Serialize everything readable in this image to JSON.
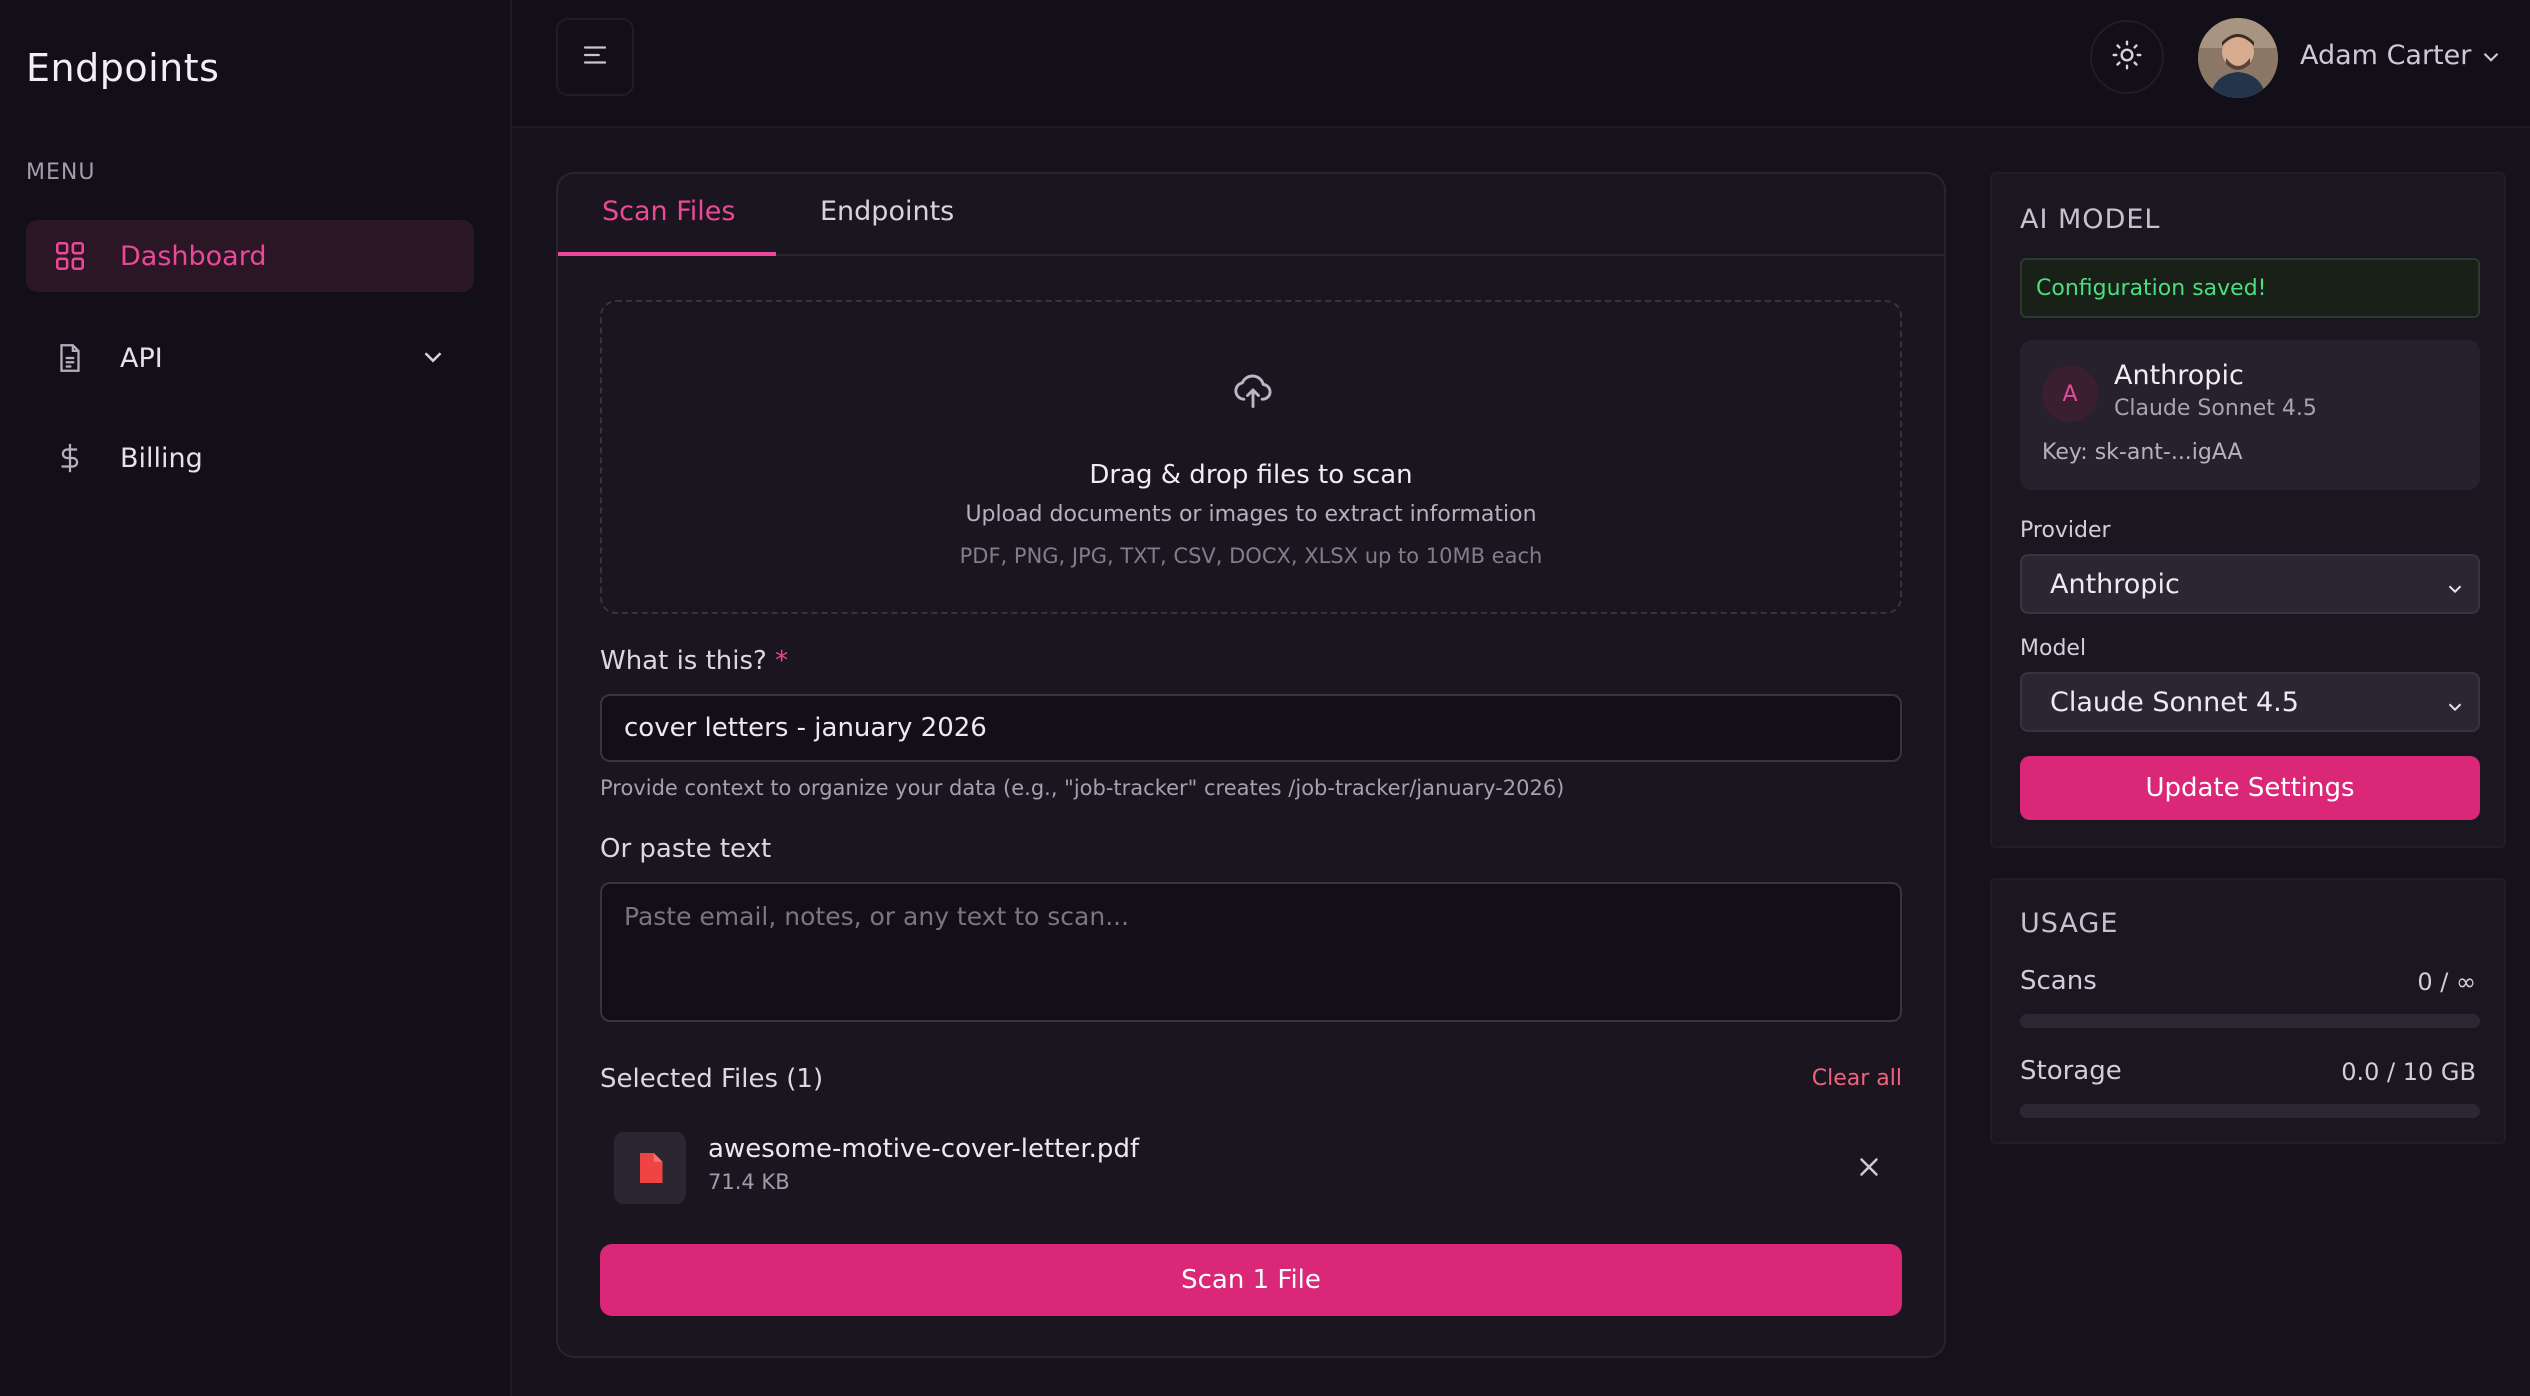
{
  "sidebar": {
    "brand": "Endpoints",
    "menu_label": "MENU",
    "items": [
      {
        "label": "Dashboard",
        "icon": "grid-icon",
        "active": true
      },
      {
        "label": "API",
        "icon": "document-icon",
        "expandable": true
      },
      {
        "label": "Billing",
        "icon": "dollar-icon"
      }
    ]
  },
  "header": {
    "user_name": "Adam Carter"
  },
  "main": {
    "tabs": [
      {
        "label": "Scan Files",
        "active": true
      },
      {
        "label": "Endpoints",
        "active": false
      }
    ],
    "dropzone": {
      "title": "Drag & drop files to scan",
      "subtitle": "Upload documents or images to extract information",
      "hint": "PDF, PNG, JPG, TXT, CSV, DOCX, XLSX up to 10MB each"
    },
    "context_field": {
      "label": "What is this?",
      "required_mark": "*",
      "value": "cover letters - january 2026",
      "help": "Provide context to organize your data (e.g., \"job-tracker\" creates /job-tracker/january-2026)"
    },
    "paste_field": {
      "label": "Or paste text",
      "placeholder": "Paste email, notes, or any text to scan..."
    },
    "selected_files": {
      "title": "Selected Files (1)",
      "clear_label": "Clear all",
      "files": [
        {
          "name": "awesome-motive-cover-letter.pdf",
          "size": "71.4 KB"
        }
      ]
    },
    "scan_button": "Scan 1 File"
  },
  "ai_model": {
    "title": "AI MODEL",
    "status": "Configuration saved!",
    "provider_card": {
      "badge": "A",
      "name": "Anthropic",
      "model": "Claude Sonnet 4.5",
      "key": "Key: sk-ant-...igAA"
    },
    "provider_label": "Provider",
    "provider_value": "Anthropic",
    "model_label": "Model",
    "model_value": "Claude Sonnet 4.5",
    "update_button": "Update Settings"
  },
  "usage": {
    "title": "USAGE",
    "rows": [
      {
        "label": "Scans",
        "value": "0 / ∞",
        "fill": 0
      },
      {
        "label": "Storage",
        "value": "0.0 / 10 GB",
        "fill": 0
      }
    ]
  },
  "colors": {
    "accent": "#ec4899",
    "button": "#db2777",
    "success": "#4ade80",
    "danger": "#f0627e",
    "background": "#16111b"
  }
}
